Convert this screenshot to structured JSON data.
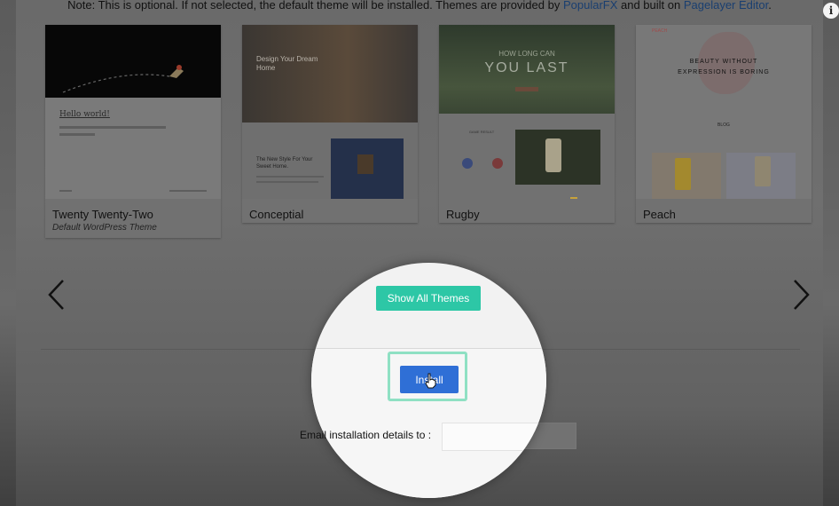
{
  "note": {
    "prefix": "Note: This is optional. If not selected, the default theme will be installed. Themes are provided by ",
    "link1": "PopularFX",
    "middle": " and built on ",
    "link2": "Pagelayer Editor",
    "suffix": ".",
    "info_icon": "i"
  },
  "themes": [
    {
      "name": "Twenty Twenty-Two",
      "subtitle": "Default WordPress Theme",
      "thumb_text": {
        "hello": "Hello world!"
      }
    },
    {
      "name": "Conceptial",
      "thumb_text": {
        "hero": "Design Your Dream Home",
        "section": "The New Style For Your Sweet Home."
      }
    },
    {
      "name": "Rugby",
      "thumb_text": {
        "tagline": "HOW LONG CAN",
        "headline": "YOU LAST",
        "game": "GAME RESULT"
      }
    },
    {
      "name": "Peach",
      "thumb_text": {
        "logo": "PEACH",
        "headline": "BEAUTY WITHOUT EXPRESSION IS BORING",
        "section": "BLOG"
      }
    }
  ],
  "carousel": {
    "prev_icon": "chevron-left-icon",
    "next_icon": "chevron-right-icon"
  },
  "buttons": {
    "show_all": "Show All Themes",
    "install": "Install"
  },
  "email": {
    "label": "Email installation details to :",
    "value": ""
  },
  "colors": {
    "accent_green": "#2dc7a6",
    "install_blue": "#2f6fd6",
    "link_blue": "#1a3f70"
  }
}
